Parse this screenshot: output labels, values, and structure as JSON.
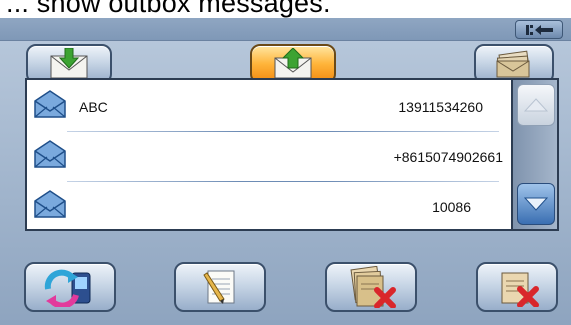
{
  "caption": {
    "text": "... show outbox messages."
  },
  "toolbar": {
    "back_icon": "back-arrow-icon",
    "tabs": [
      {
        "name": "inbox",
        "icon": "inbox-download-envelope-icon",
        "active": false
      },
      {
        "name": "outbox",
        "icon": "outbox-upload-envelope-icon",
        "active": true
      },
      {
        "name": "drafts",
        "icon": "drafts-stack-envelope-icon",
        "active": false
      }
    ]
  },
  "messages": [
    {
      "name": "ABC",
      "number": "13911534260",
      "icon": "envelope-icon"
    },
    {
      "name": "",
      "number": "+8615074902661",
      "icon": "envelope-icon"
    },
    {
      "name": "",
      "number": "10086",
      "icon": "envelope-icon"
    }
  ],
  "scrollbar": {
    "up_icon": "scroll-up-icon",
    "down_icon": "scroll-down-icon"
  },
  "actions": [
    {
      "name": "sync",
      "icon": "sync-phone-icon"
    },
    {
      "name": "compose",
      "icon": "compose-note-icon"
    },
    {
      "name": "delete-all",
      "icon": "delete-all-messages-icon"
    },
    {
      "name": "delete",
      "icon": "delete-message-icon"
    }
  ],
  "colors": {
    "active_tab": "#ffb43a",
    "panel": "#9fb3cb",
    "accent_blue": "#3a6fb2"
  }
}
